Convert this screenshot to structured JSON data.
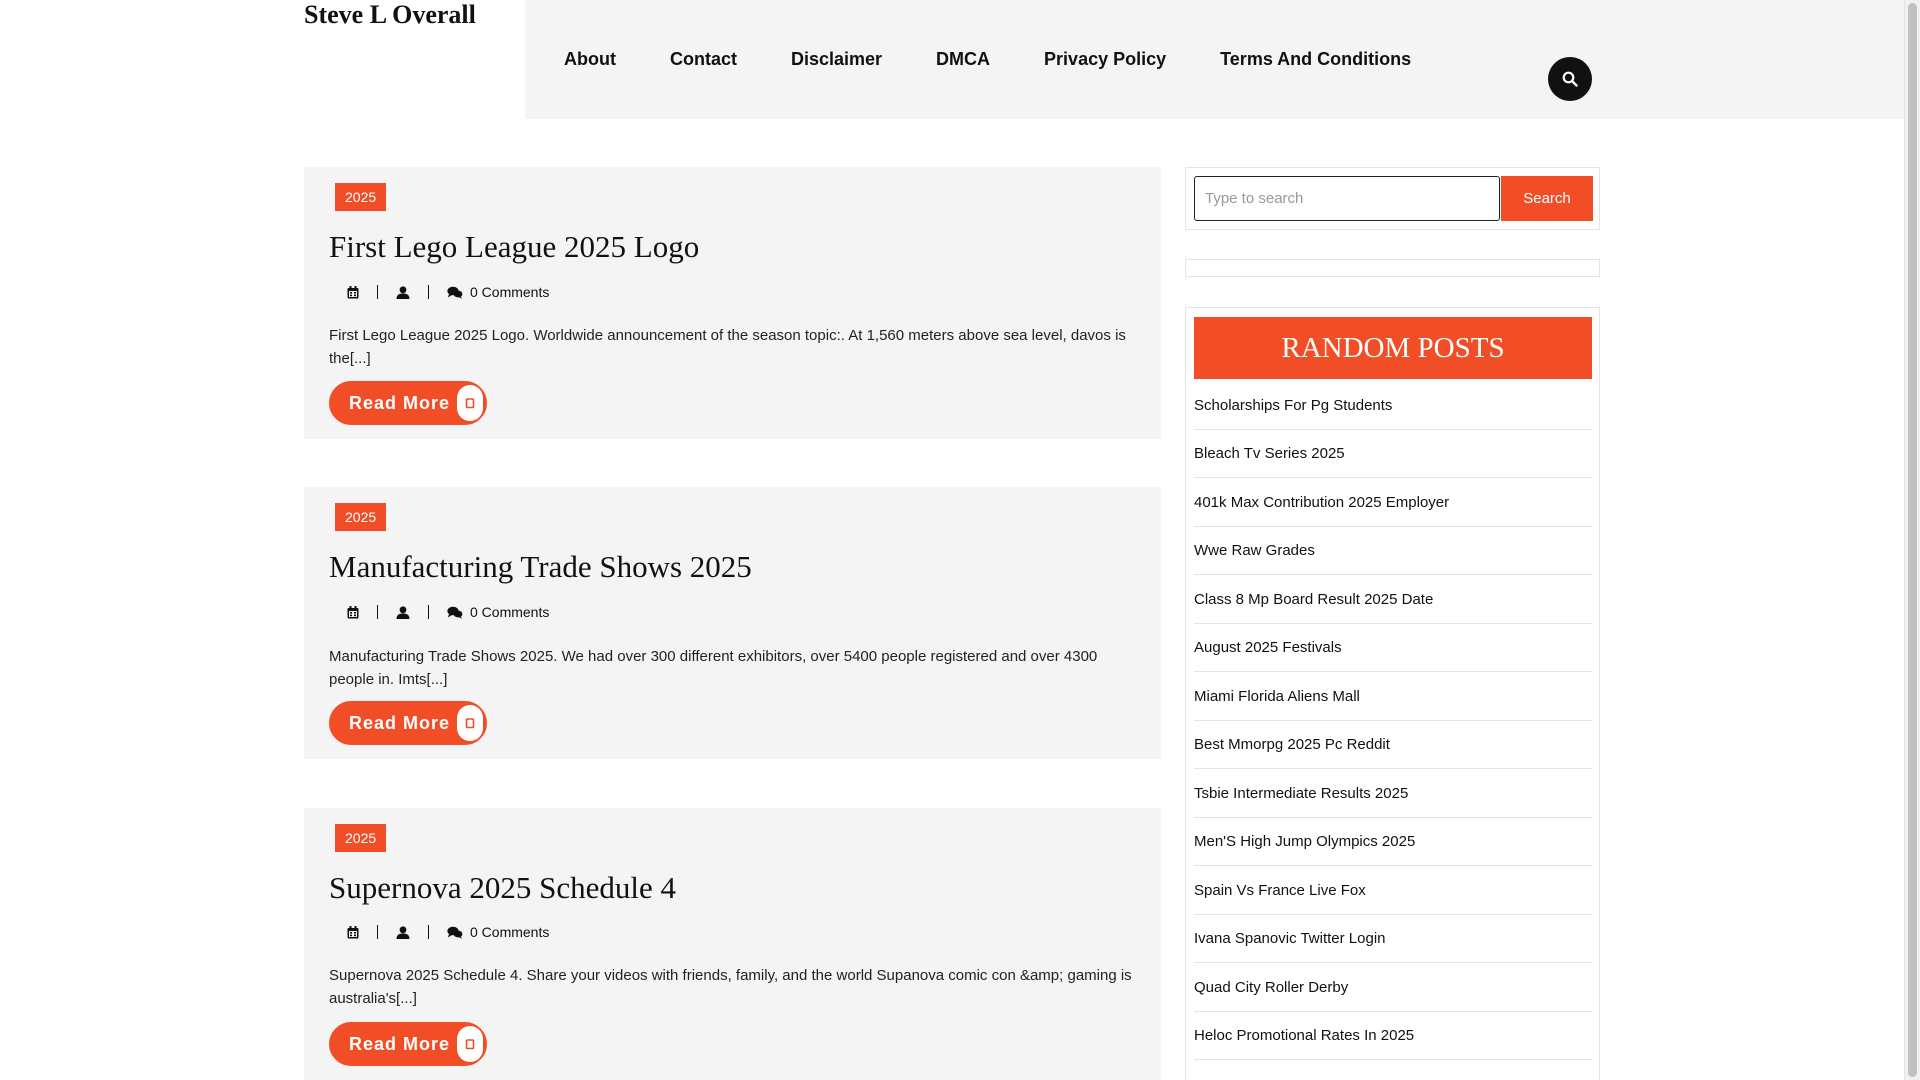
{
  "site": {
    "brand": "Steve L Overall"
  },
  "nav": {
    "items": [
      "About",
      "Contact",
      "Disclaimer",
      "DMCA",
      "Privacy Policy",
      "Terms And Conditions"
    ],
    "search_icon": "search-icon"
  },
  "posts": [
    {
      "tag": "2025",
      "title": "First Lego League 2025 Logo",
      "comments": "0 Comments",
      "excerpt": "First Lego League 2025 Logo. Worldwide announcement of the season topic:. At 1,560 meters above sea level, davos is the[...]",
      "button": "Read More"
    },
    {
      "tag": "2025",
      "title": "Manufacturing Trade Shows 2025",
      "comments": "0 Comments",
      "excerpt": "Manufacturing Trade Shows 2025. We had over 300 different exhibitors, over 5400 people registered and over 4300 people in. Imts[...]",
      "button": "Read More"
    },
    {
      "tag": "2025",
      "title": "Supernova 2025 Schedule 4",
      "comments": "0 Comments",
      "excerpt": "Supernova 2025 Schedule 4. Share your videos with friends, family, and the world Supanova comic con &amp; gaming is australia's[...]",
      "button": "Read More"
    }
  ],
  "sidebar": {
    "search": {
      "placeholder": "Type to search",
      "button": "Search"
    },
    "random_posts": {
      "title": "RANDOM POSTS",
      "items": [
        "Scholarships For Pg Students",
        "Bleach Tv Series 2025",
        "401k Max Contribution 2025 Employer",
        "Wwe Raw Grades",
        "Class 8 Mp Board Result 2025 Date",
        "August 2025 Festivals",
        "Miami Florida Aliens Mall",
        "Best Mmorpg 2025 Pc Reddit",
        "Tsbie Intermediate Results 2025",
        "Men'S High Jump Olympics 2025",
        "Spain Vs France Live Fox",
        "Ivana Spanovic Twitter Login",
        "Quad City Roller Derby",
        "Heloc Promotional Rates In 2025"
      ]
    }
  },
  "colors": {
    "accent": "#f14e27",
    "panel": "#f4f4f4",
    "text": "#111111"
  }
}
